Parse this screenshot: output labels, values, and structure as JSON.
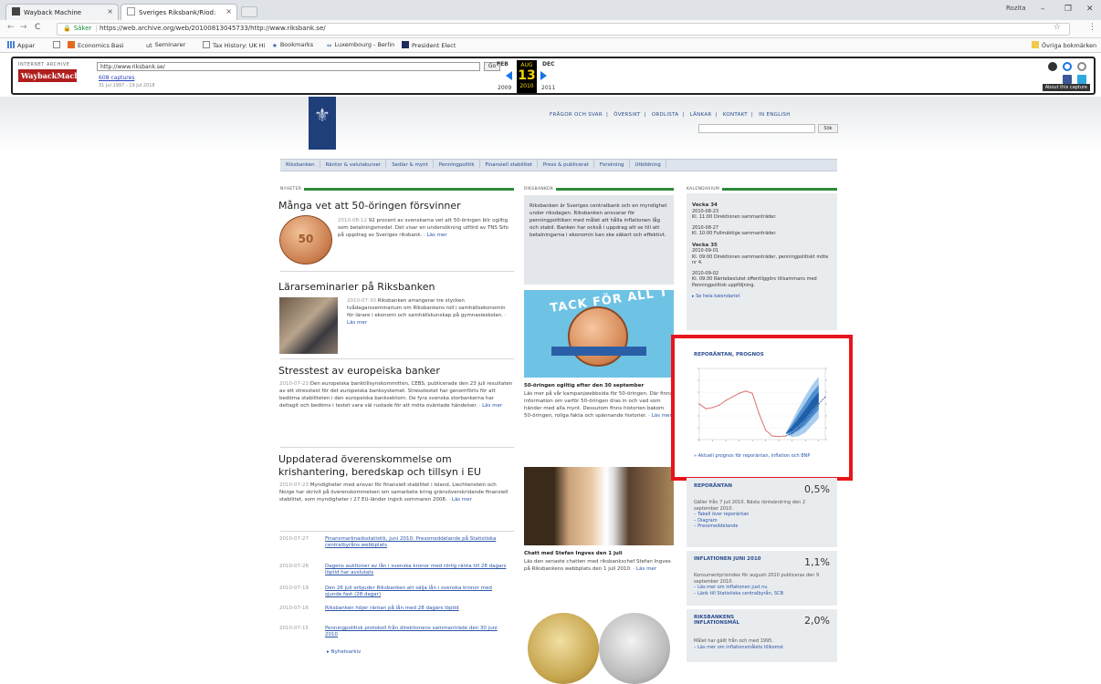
{
  "browser": {
    "tabs": [
      {
        "title": "Wayback Machine"
      },
      {
        "title": "Sveriges Riksbank/Riod:"
      }
    ],
    "user": "Rozita",
    "url_secure_label": "Säker",
    "url": "https://web.archive.org/web/20100813045733/http://www.riksbank.se/",
    "bookmarks": [
      "Appar",
      "Economics Basi",
      "Seminarer",
      "Tax History: UK Hi",
      "Bookmarks",
      "Luxembourg - Berlin",
      "President Elect"
    ],
    "other_bookmarks": "Övriga bokmärken"
  },
  "wayback": {
    "logo_top": "INTERNET ARCHIVE",
    "logo_main": "WaybackMachine",
    "url_value": "http://www.riksbank.se/",
    "go_label": "Go",
    "captures": "608 captures",
    "range": "31 Jul 1997 - 19 Jul 2018",
    "prev_month": "FEB",
    "cur_month": "AUG",
    "cur_day": "13",
    "next_month": "DEC",
    "prev_year": "2009",
    "cur_year": "2010",
    "next_year": "2011",
    "about": "About this capture"
  },
  "site": {
    "top_nav": [
      "FRÅGOR OCH SVAR",
      "ÖVERSIKT",
      "ORDLISTA",
      "LÄNKAR",
      "KONTAKT",
      "IN ENGLISH"
    ],
    "search_button": "Sök",
    "main_nav": [
      "Riksbanken",
      "Räntor & valutakurser",
      "Sedlar & mynt",
      "Penningpolitik",
      "Finansiell stabilitet",
      "Press & publicerat",
      "Forskning",
      "Utbildning"
    ],
    "sections": {
      "left": "NYHETER",
      "mid": "RIKSBANKEN",
      "right": "KALENDARIUM"
    },
    "articles": [
      {
        "title": "Många vet att 50-öringen försvinner",
        "date": "2010-08-12",
        "body": "92 procent av svenskarna vet att 50-öringen blir ogiltig som betalningsmedel. Det visar en undersökning utförd av TNS Sifo på uppdrag av Sveriges riksbank.",
        "more": "Läs mer"
      },
      {
        "title": "Lärarseminarier på Riksbanken",
        "date": "2010-07-30",
        "body": "Riksbanken arrangerar tre stycken tvådagarsseminarium om Riksbankens roll i samhällsekonomin för lärare i ekonomi och samhällskunskap på gymnasieskolan.",
        "more": "Läs mer"
      },
      {
        "title": "Stresstest av europeiska banker",
        "date": "2010-07-23",
        "body": "Den europeiska banktillsynskommittén, CEBS, publicerade den 23 juli resultaten av ett stresstest för det europeiska banksystemet. Stresstestet har genomförts för att bedöma stabiliteten i den europeiska banksektorn. De fyra svenska storbankerna har deltagit och bedöms i testet vara väl rustade för att möta oväntade händelser.",
        "more": "Läs mer"
      },
      {
        "title": "Uppdaterad överenskommelse om",
        "title2": "krishantering, beredskap och tillsyn i EU",
        "date": "2010-07-23",
        "body": "Myndigheter med ansvar för finansiell stabilitet i Island, Liechtenstein och Norge har skrivit på överenskommelsen om samarbete kring gränsöverskridande finansiell stabilitet, som myndigheter i 27 EU-länder ingick sommaren 2008.",
        "more": "Läs mer"
      }
    ],
    "news_list": [
      {
        "date": "2010-07-27",
        "text": "Finansmarknadsstatistik, juni 2010: Pressmeddelande på Statistiska centralbyråns webbplats"
      },
      {
        "date": "2010-07-26",
        "text": "Dagens auktioner av lån i svenska kronor med rörlig ränta till 28 dagars löptid har avslutats"
      },
      {
        "date": "2010-07-19",
        "text": "Den 26 juli erbjuder Riksbanken att sälja lån i svenska kronor med sjunde fast (28 dagar)"
      },
      {
        "date": "2010-07-16",
        "text": "Riksbanken höjer räntan på lån med 28 dagars löptid"
      },
      {
        "date": "2010-07-15",
        "text": "Penningpolitisk protokoll från direktionens sammanträde den 30 juni 2010"
      }
    ],
    "news_archive": "Nyhetsarkiv",
    "mid_intro": "Riksbanken är Sveriges centralbank och en myndighet under riksdagen. Riksbanken ansvarar för penningpolitiken med målet att hålla inflationen låg och stabil. Banken har också i uppdrag att se till att betalningarna i ekonomin kan ske säkert och effektivt.",
    "tack_text": "TACK FÖR ALL T",
    "coin_label": "50",
    "promo_head": "50-öringen ogiltig efter den 30 september",
    "promo_body": "Läs mer på vår kampanjwebbsida för 50-öringen. Där finns information om varför 50-öringen dras in och vad som händer med alla mynt. Dessutom finns historien bakom 50-öringen, roliga fakta och spännande historier.",
    "promo_more": "Läs mer",
    "chat_head": "Chatt med Stefan Ingves den 1 juli",
    "chat_body": "Läs den senaste chatten med riksbankschef Stefan Ingves på Riksbankens webbplats den 1 juli 2010.",
    "chat_more": "Läs mer",
    "calendar": [
      {
        "week": "Vecka 34",
        "date": "2010-08-23",
        "text": "Kl. 11:00 Direktionen sammanträder."
      },
      {
        "week": "",
        "date": "2010-08-27",
        "text": "Kl. 10:00 Fullmäktige sammanträder."
      },
      {
        "week": "Vecka 35",
        "date": "2010-09-01",
        "text": "Kl. 09:00 Direktionen sammanträder, penningpolitiskt möte nr 4."
      },
      {
        "week": "",
        "date": "2010-09-02",
        "text": "Kl. 09:30 Räntebeslutet offentliggörs tillsammans med Penningpolitisk uppföljning."
      }
    ],
    "calendar_link": "Se hela kalendariet",
    "chart": {
      "title": "REPORÄNTAN, PROGNOS",
      "link": "Aktuell prognos för reporäntan, inflation och BNP"
    },
    "rates": [
      {
        "title": "REPORÄNTAN",
        "value": "0,5%",
        "body": "Gäller från 7 juli 2010. Nästa ränteändring den 2 september 2010.",
        "links": [
          "Tabell över reporäntan",
          "Diagram",
          "Pressmeddelande"
        ]
      },
      {
        "title": "INFLATIONEN JUNI 2010",
        "value": "1,1%",
        "body": "Konsumentprisindex för augusti 2010 publiceras den 9 september 2010.",
        "links": [
          "Läs mer om inflationen just nu",
          "Länk till Statistiska centralbyrån, SCB"
        ]
      },
      {
        "title": "RIKSBANKENS INFLATIONSMÅL",
        "value": "2,0%",
        "body": "Målet har gällt från och med 1995.",
        "links": [
          "Läs mer om inflationsmålets tillkomst"
        ]
      }
    ]
  },
  "chart_data": {
    "type": "line",
    "title": "REPORÄNTAN, PROGNOS",
    "series": [
      {
        "values": [
          3.0,
          2.6,
          2.7,
          2.9,
          3.3,
          3.6,
          3.9,
          4.1,
          3.9,
          2.2,
          0.8,
          0.3,
          0.25,
          0.3,
          0.5,
          1.0,
          1.6,
          2.3,
          3.0,
          3.6
        ]
      }
    ],
    "fan": {
      "start_index": 13,
      "upper": [
        0.5,
        1.6,
        2.7,
        3.7,
        4.6,
        5.3
      ],
      "lower": [
        0.5,
        0.2,
        0.3,
        0.6,
        1.2,
        1.8
      ]
    },
    "ylim": [
      0,
      6
    ],
    "colors": {
      "line": "#e07a7a",
      "fan_dark": "#1f5fa8",
      "fan_mid": "#4d8fd0",
      "fan_light": "#a9cdef",
      "forecast": "#2b4d8f"
    }
  }
}
